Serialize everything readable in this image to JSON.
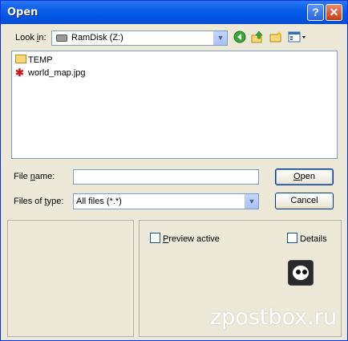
{
  "window": {
    "title": "Open",
    "help_label": "?",
    "close_label": "✕"
  },
  "lookin": {
    "label_pre": "Look ",
    "label_accel": "i",
    "label_post": "n:",
    "value": "RamDisk (Z:)"
  },
  "toolbar": {
    "back_icon": "back-icon",
    "up_icon": "up-folder-icon",
    "newfolder_icon": "new-folder-icon",
    "views_icon": "views-menu-icon"
  },
  "files": [
    {
      "name": "TEMP",
      "icon": "folder-icon"
    },
    {
      "name": "world_map.jpg",
      "icon": "image-file-icon"
    }
  ],
  "filename": {
    "label_pre": "File ",
    "label_accel": "n",
    "label_post": "ame:",
    "value": ""
  },
  "filetype": {
    "label_pre": "Files of ",
    "label_accel": "t",
    "label_post": "ype:",
    "value": "All files (*.*)"
  },
  "buttons": {
    "open_accel": "O",
    "open_rest": "pen",
    "cancel": "Cancel"
  },
  "preview": {
    "label_accel": "P",
    "label_rest": "review active",
    "checked": false,
    "details_label": "Details",
    "details_checked": false
  },
  "watermark": "zpostbox.ru"
}
